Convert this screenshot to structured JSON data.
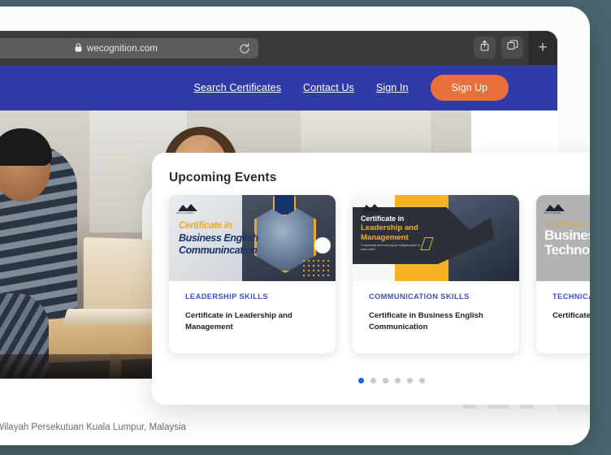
{
  "browser": {
    "url": "wecognition.com",
    "lock_icon": "lock-icon",
    "reload_icon": "reload-icon",
    "share_icon": "share-icon",
    "tabs_icon": "tabs-overview-icon",
    "new_tab_label": "+"
  },
  "site_nav": {
    "links": [
      {
        "label": "Search Certificates"
      },
      {
        "label": "Contact Us"
      },
      {
        "label": "Sign In"
      }
    ],
    "signup_label": "Sign Up",
    "nav_color": "#2f3ba8",
    "accent_color": "#e8703a"
  },
  "events": {
    "title": "Upcoming Events",
    "cards": [
      {
        "category": "LEADERSHIP SKILLS",
        "name": "Certificate in Leadership and Management",
        "banner": {
          "brand": "MDIS ACADEMY",
          "line1": "Certificate in",
          "line2": "Business English",
          "line3": "Communincation"
        }
      },
      {
        "category": "COMMUNICATION SKILLS",
        "name": "Certificate in Business English Communication",
        "banner": {
          "brand": "MDIS ACADEMY",
          "line1": "Certificate in",
          "line2": "Leadership and",
          "line3": "Management",
          "subtitle": "\"Leadership and learning are indispensable to each other.\""
        }
      },
      {
        "category": "TECHNICAL SKILLS",
        "name": "Certificate in Business Technology",
        "banner": {
          "brand": "MDIS ACADEMY",
          "line1": "Certificate in",
          "line2": "Business",
          "line3": "Technology"
        }
      }
    ],
    "dots": {
      "count": 6,
      "active_index": 0,
      "active_color": "#1769e0",
      "inactive_color": "#c9c9c9"
    }
  },
  "address": {
    "text": "a Lumpur, Wilayah Persekutuan Kuala Lumpur, Malaysia"
  },
  "page_background": "#4a6770"
}
